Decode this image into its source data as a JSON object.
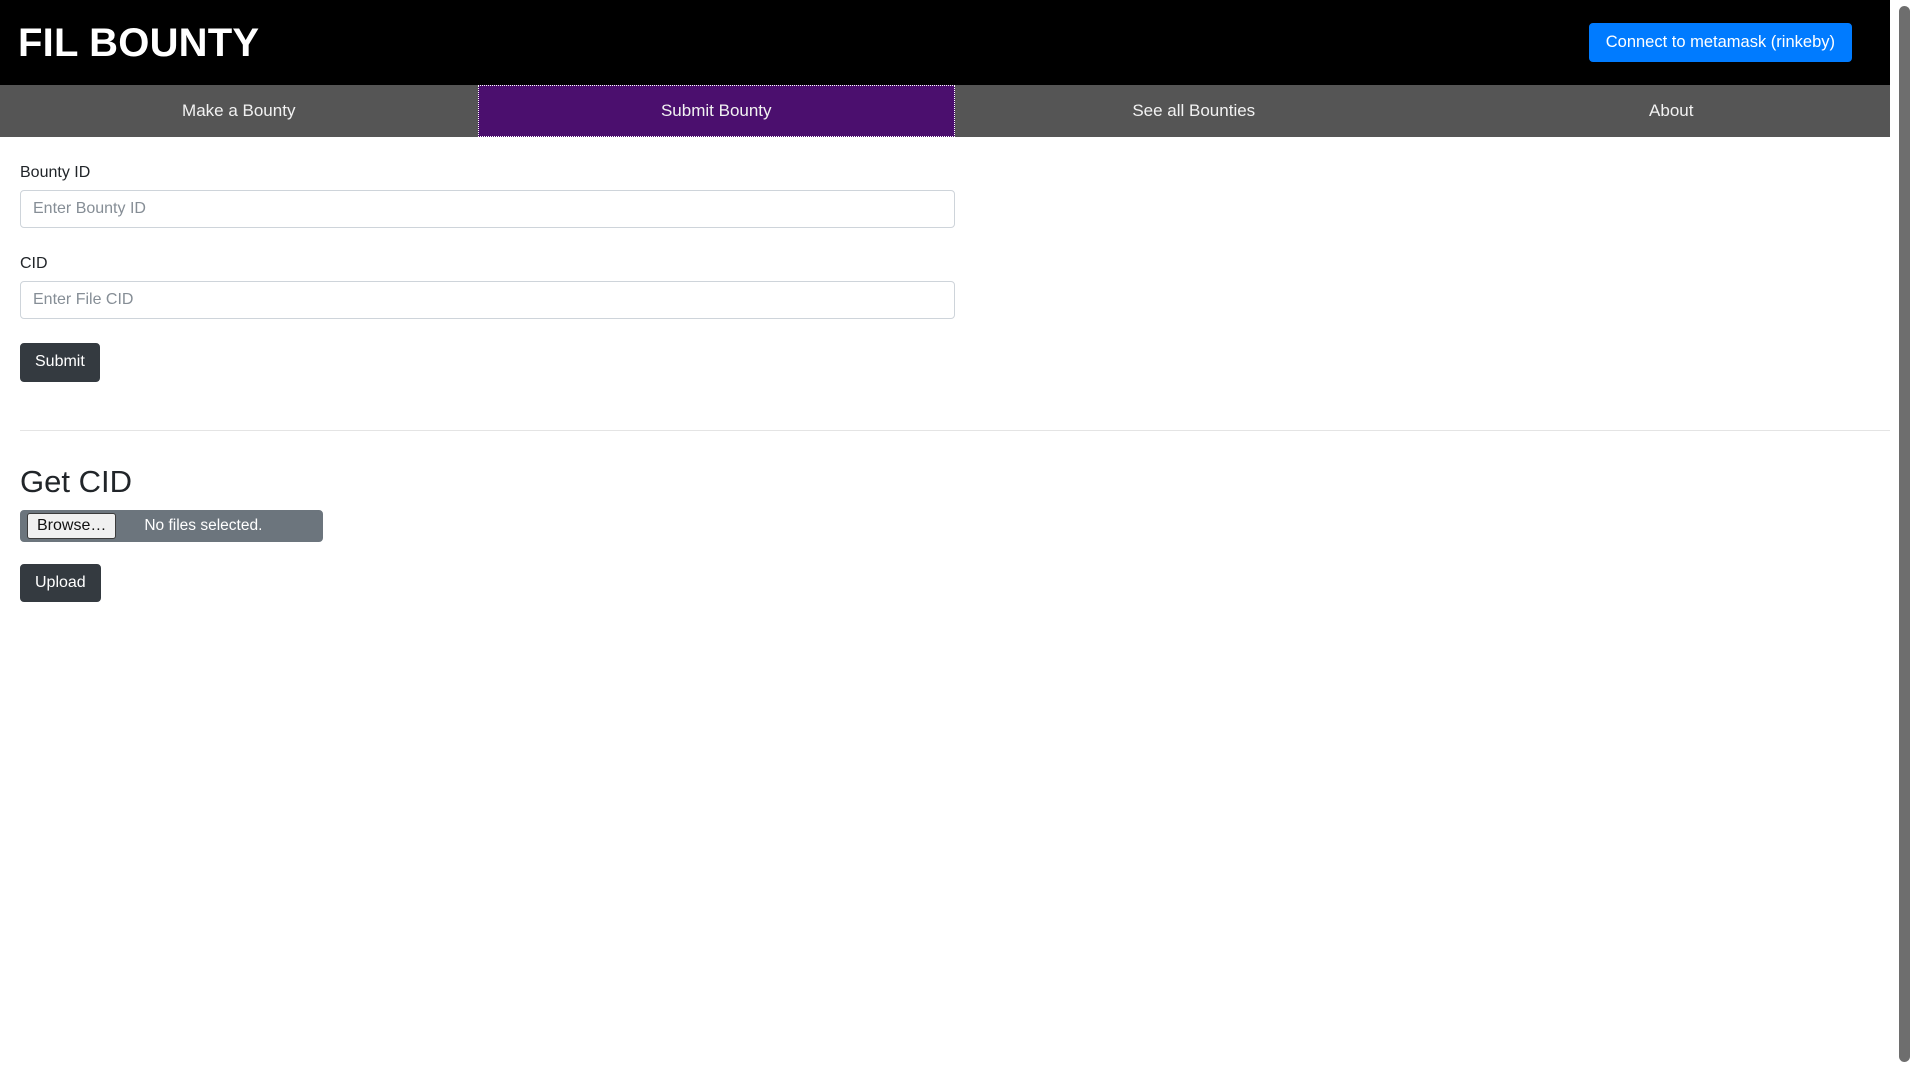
{
  "header": {
    "brand": "FIL BOUNTY",
    "connect_button": "Connect to metamask (rinkeby)",
    "background_color": "#000000",
    "connect_button_color": "#007bff"
  },
  "nav": {
    "active_index": 1,
    "active_color": "#4b0f6e",
    "inactive_color": "#555555",
    "items": [
      {
        "label": "Make a Bounty"
      },
      {
        "label": "Submit Bounty"
      },
      {
        "label": "See all Bounties"
      },
      {
        "label": "About"
      }
    ]
  },
  "form": {
    "bounty_id": {
      "label": "Bounty ID",
      "placeholder": "Enter Bounty ID",
      "value": ""
    },
    "cid": {
      "label": "CID",
      "placeholder": "Enter File CID",
      "value": ""
    },
    "submit_label": "Submit"
  },
  "get_cid": {
    "title": "Get CID",
    "browse_label": "Browse…",
    "file_status": "No files selected.",
    "upload_label": "Upload"
  },
  "scrollbar": {
    "thumb_color": "#6e6e6e"
  }
}
